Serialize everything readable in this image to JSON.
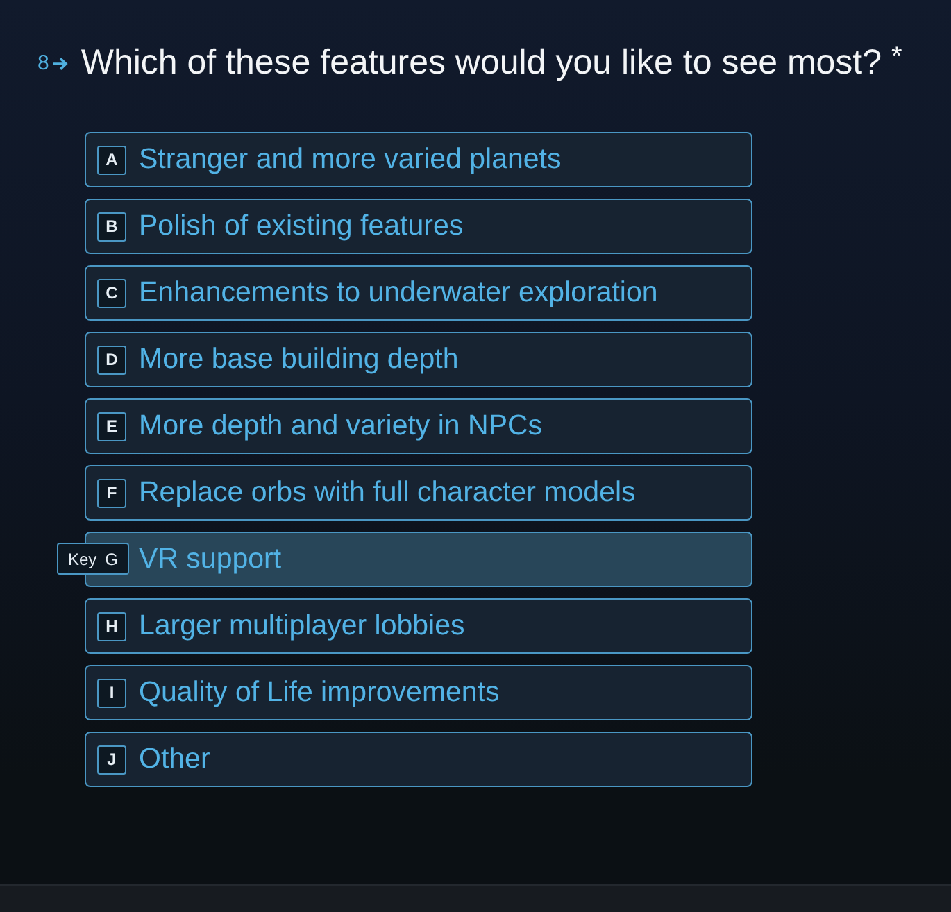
{
  "question": {
    "number": "8",
    "text": "Which of these features would you like to see most?",
    "required_mark": "*"
  },
  "key_hint_label": "Key",
  "options": [
    {
      "key": "A",
      "label": "Stranger and more varied planets",
      "hovered": false
    },
    {
      "key": "B",
      "label": "Polish of existing features",
      "hovered": false
    },
    {
      "key": "C",
      "label": "Enhancements to underwater exploration",
      "hovered": false
    },
    {
      "key": "D",
      "label": "More base building depth",
      "hovered": false
    },
    {
      "key": "E",
      "label": "More depth and variety in NPCs",
      "hovered": false
    },
    {
      "key": "F",
      "label": "Replace orbs with full character models",
      "hovered": false
    },
    {
      "key": "G",
      "label": "VR support",
      "hovered": true
    },
    {
      "key": "H",
      "label": "Larger multiplayer lobbies",
      "hovered": false
    },
    {
      "key": "I",
      "label": "Quality of Life improvements",
      "hovered": false
    },
    {
      "key": "J",
      "label": "Other",
      "hovered": false
    }
  ]
}
